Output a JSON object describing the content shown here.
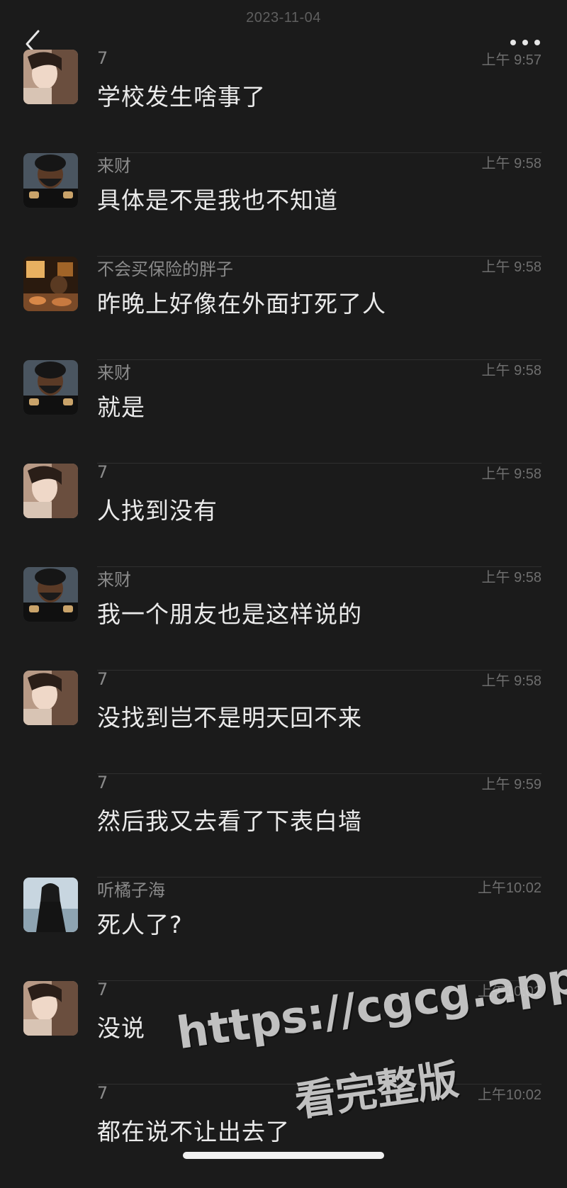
{
  "header": {
    "date": "2023-11-04"
  },
  "messages": [
    {
      "avatar": "girl-avatar",
      "name": "7",
      "time": "上午 9:57",
      "text": "学校发生啥事了"
    },
    {
      "avatar": "bearded-man-avatar",
      "name": "来财",
      "time": "上午 9:58",
      "text": "具体是不是我也不知道"
    },
    {
      "avatar": "dinner-table-avatar",
      "name": "不会买保险的胖子",
      "time": "上午 9:58",
      "text": "昨晚上好像在外面打死了人"
    },
    {
      "avatar": "bearded-man-avatar",
      "name": "来财",
      "time": "上午 9:58",
      "text": "就是"
    },
    {
      "avatar": "girl-avatar",
      "name": "7",
      "time": "上午 9:58",
      "text": "人找到没有"
    },
    {
      "avatar": "bearded-man-avatar",
      "name": "来财",
      "time": "上午 9:58",
      "text": "我一个朋友也是这样说的"
    },
    {
      "avatar": "girl-avatar",
      "name": "7",
      "time": "上午 9:58",
      "text": "没找到岂不是明天回不来"
    },
    {
      "avatar": "",
      "name": "7",
      "time": "上午 9:59",
      "text": "然后我又去看了下表白墙"
    },
    {
      "avatar": "dark-coat-person-avatar",
      "name": "听橘子海",
      "time": "上午10:02",
      "text": "死人了?"
    },
    {
      "avatar": "girl-avatar",
      "name": "7",
      "time": "上午10:02",
      "text": "没说"
    },
    {
      "avatar": "",
      "name": "7",
      "time": "上午10:02",
      "text": "都在说不让出去了"
    }
  ],
  "watermark": {
    "line1": "https://cgcg.app",
    "line2": "看完整版"
  },
  "icons": {
    "back": "chevron-left-icon",
    "more": "more-dots-icon"
  }
}
